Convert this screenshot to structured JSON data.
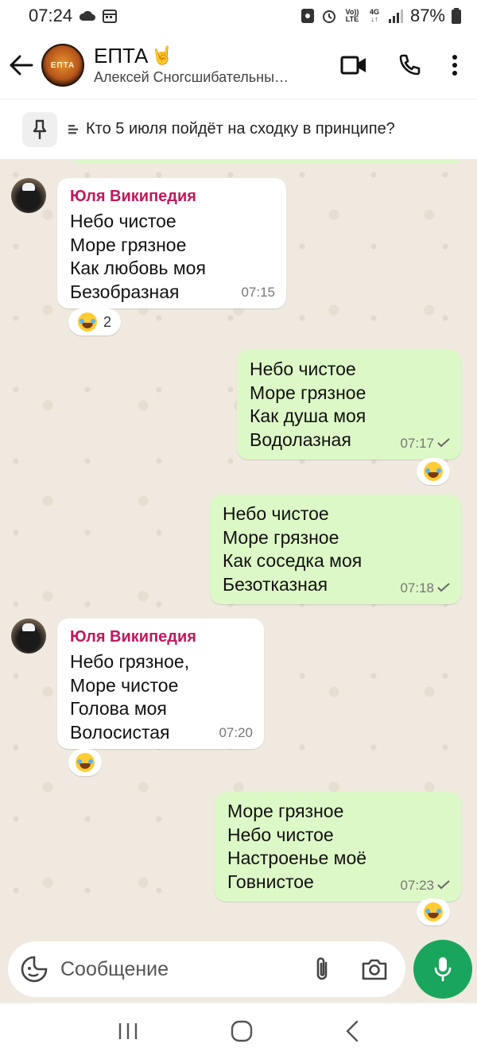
{
  "status_bar": {
    "time": "07:24",
    "network": "4G",
    "volte": "Vo)) LTE",
    "battery": "87%"
  },
  "header": {
    "title": "ЕПТА",
    "title_emoji": "🤘",
    "subtitle": "Алексей Сногсшибательны…",
    "avatar_text": "ЕПТА",
    "icons": [
      "back-arrow-icon",
      "video-call-icon",
      "phone-icon",
      "more-vert-icon"
    ]
  },
  "pinned": {
    "text": "Кто 5 июля пойдёт на сходку в принципе?"
  },
  "messages": [
    {
      "direction": "in",
      "sender": "Юля Википедия",
      "lines": [
        "Небо чистое",
        "Море грязное",
        "Как любовь моя",
        "Безобразная"
      ],
      "time": "07:15",
      "reaction": {
        "emoji": "😂",
        "count": "2"
      }
    },
    {
      "direction": "out",
      "lines": [
        "Небо чистое",
        "Море грязное",
        "Как душа моя",
        "Водолазная"
      ],
      "time": "07:17",
      "reaction": {
        "emoji": "😂"
      }
    },
    {
      "direction": "out",
      "lines": [
        "Небо чистое",
        "Море грязное",
        "Как соседка моя",
        "Безотказная"
      ],
      "time": "07:18"
    },
    {
      "direction": "in",
      "sender": "Юля Википедия",
      "lines": [
        "Небо грязное,",
        "Море чистое",
        "Голова моя",
        "Волосистая"
      ],
      "time": "07:20",
      "reaction": {
        "emoji": "😂"
      }
    },
    {
      "direction": "out",
      "lines": [
        "Море грязное",
        "Небо чистое",
        "Настроенье моё",
        "Говнистое"
      ],
      "time": "07:23",
      "reaction": {
        "emoji": "😂"
      }
    }
  ],
  "input": {
    "placeholder": "Сообщение"
  },
  "colors": {
    "outgoing_bubble": "#dcf8c6",
    "sender_name": "#c2185b",
    "mic_button": "#1aa55c"
  }
}
